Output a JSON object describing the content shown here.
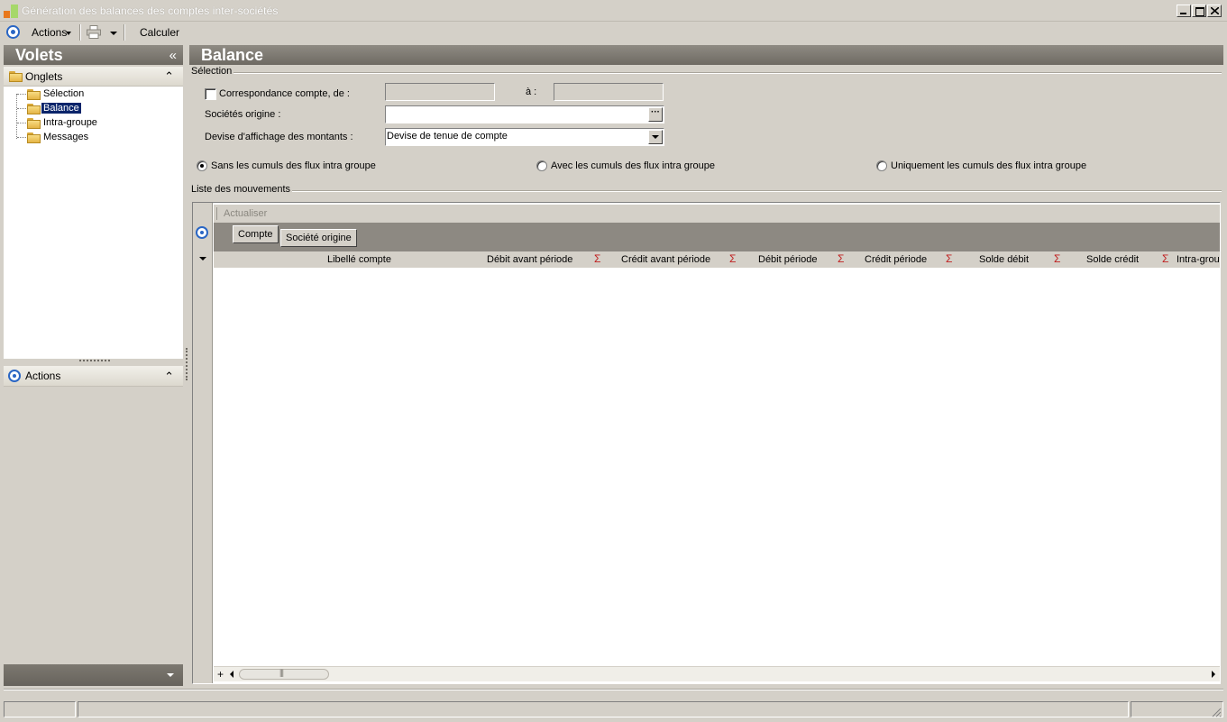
{
  "window": {
    "title": "Génération des balances des comptes inter-sociétés"
  },
  "toolbar": {
    "actions_label": "Actions",
    "calculate_label": "Calculer"
  },
  "left_panel": {
    "volets_title": "Volets",
    "onglets_title": "Onglets",
    "tree_items": [
      {
        "label": "Sélection",
        "selected": false
      },
      {
        "label": "Balance",
        "selected": true
      },
      {
        "label": "Intra-groupe",
        "selected": false
      },
      {
        "label": "Messages",
        "selected": false
      }
    ],
    "actions_title": "Actions"
  },
  "content": {
    "title": "Balance",
    "selection_group": "Sélection",
    "correspondance_label": "Correspondance compte, de :",
    "correspondance_checked": false,
    "from_value": "",
    "to_label": "à :",
    "to_value": "",
    "societes_label": "Sociétés origine :",
    "societes_value": "",
    "devise_label": "Devise d'affichage des montants :",
    "devise_value": "Devise de tenue de compte",
    "radio_options": [
      {
        "label": "Sans les cumuls des flux intra groupe",
        "checked": true
      },
      {
        "label": "Avec les cumuls des flux intra groupe",
        "checked": false
      },
      {
        "label": "Uniquement les cumuls des flux intra groupe",
        "checked": false
      }
    ],
    "mouvements_group": "Liste des mouvements",
    "refresh_label": "Actualiser",
    "group_chips": [
      "Compte",
      "Société origine"
    ],
    "columns": [
      "Libellé compte",
      "Débit avant période",
      "Crédit avant période",
      "Débit période",
      "Crédit période",
      "Solde débit",
      "Solde crédit",
      "Intra-grou"
    ],
    "sigma_symbol": "Σ",
    "rows": []
  },
  "colors": {
    "panel_header": "#7c7870",
    "selection_highlight": "#0a246a",
    "sigma": "#c02020",
    "accent_circle": "#2a66c4"
  }
}
